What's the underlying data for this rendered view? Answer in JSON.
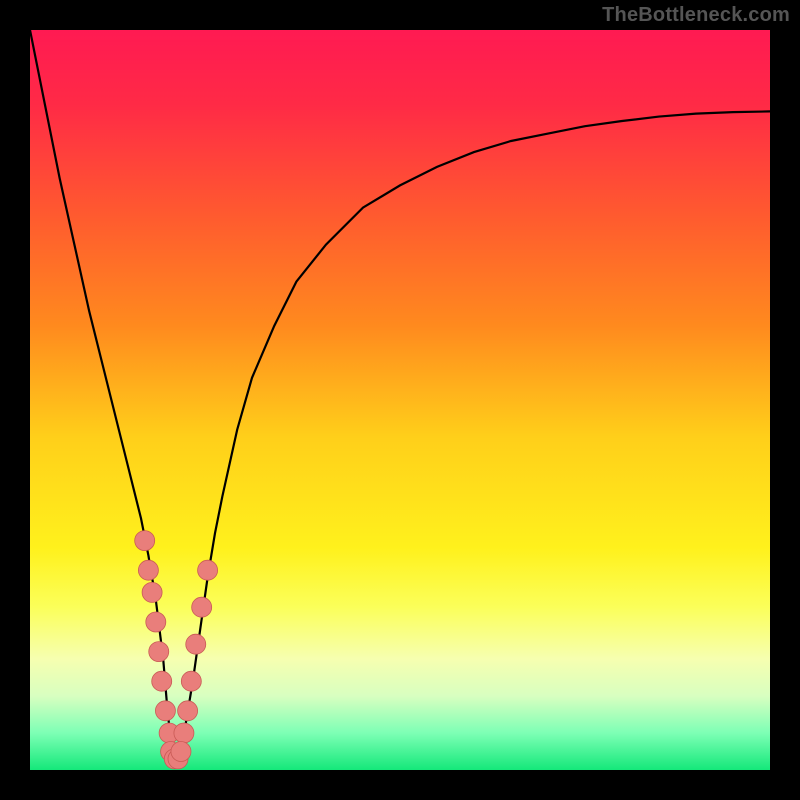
{
  "branding": {
    "text": "TheBottleneck.com"
  },
  "colors": {
    "gradient_stops": [
      {
        "offset": 0.0,
        "color": "#ff1a52"
      },
      {
        "offset": 0.1,
        "color": "#ff2a46"
      },
      {
        "offset": 0.25,
        "color": "#ff5a2f"
      },
      {
        "offset": 0.4,
        "color": "#ff8a1e"
      },
      {
        "offset": 0.55,
        "color": "#ffcf1a"
      },
      {
        "offset": 0.7,
        "color": "#fff11c"
      },
      {
        "offset": 0.78,
        "color": "#fbff5a"
      },
      {
        "offset": 0.85,
        "color": "#f6ffb0"
      },
      {
        "offset": 0.9,
        "color": "#d8ffc0"
      },
      {
        "offset": 0.95,
        "color": "#7dffb5"
      },
      {
        "offset": 1.0,
        "color": "#14e87a"
      }
    ],
    "curve": "#000000",
    "cluster_fill": "#e97e7b",
    "cluster_stroke": "#c95a55"
  },
  "chart_data": {
    "type": "line",
    "title": "",
    "xlabel": "",
    "ylabel": "",
    "xlim": [
      0,
      100
    ],
    "ylim": [
      0,
      100
    ],
    "grid": false,
    "legend": false,
    "series": [
      {
        "name": "bottleneck-curve",
        "x": [
          0,
          2,
          4,
          6,
          8,
          10,
          12,
          14,
          15,
          16,
          17,
          18,
          18.5,
          19,
          19.3,
          19.7,
          20,
          20.5,
          21,
          22,
          23,
          24,
          25,
          26,
          28,
          30,
          33,
          36,
          40,
          45,
          50,
          55,
          60,
          65,
          70,
          75,
          80,
          85,
          90,
          95,
          100
        ],
        "y": [
          100,
          90,
          80,
          71,
          62,
          54,
          46,
          38,
          34,
          29,
          23,
          15,
          9,
          4,
          2,
          1,
          1.5,
          3,
          6,
          12,
          19,
          26,
          32,
          37,
          46,
          53,
          60,
          66,
          71,
          76,
          79,
          81.5,
          83.5,
          85,
          86,
          87,
          87.7,
          88.3,
          88.7,
          88.9,
          89
        ]
      }
    ],
    "minimum": {
      "x": 19.5,
      "y": 1
    },
    "clusters": [
      {
        "name": "left-branch-points",
        "points": [
          {
            "x": 15.5,
            "y": 31
          },
          {
            "x": 16.0,
            "y": 27
          },
          {
            "x": 16.5,
            "y": 24
          },
          {
            "x": 17.0,
            "y": 20
          },
          {
            "x": 17.4,
            "y": 16
          },
          {
            "x": 17.8,
            "y": 12
          },
          {
            "x": 18.3,
            "y": 8
          },
          {
            "x": 18.8,
            "y": 5
          }
        ]
      },
      {
        "name": "right-branch-points",
        "points": [
          {
            "x": 20.8,
            "y": 5
          },
          {
            "x": 21.3,
            "y": 8
          },
          {
            "x": 21.8,
            "y": 12
          },
          {
            "x": 22.4,
            "y": 17
          },
          {
            "x": 23.2,
            "y": 22
          },
          {
            "x": 24.0,
            "y": 27
          }
        ]
      },
      {
        "name": "bottom-points",
        "points": [
          {
            "x": 19.0,
            "y": 2.5
          },
          {
            "x": 19.5,
            "y": 1.5
          },
          {
            "x": 20.0,
            "y": 1.5
          },
          {
            "x": 20.4,
            "y": 2.5
          }
        ]
      }
    ],
    "dot_radius_px": 10
  }
}
